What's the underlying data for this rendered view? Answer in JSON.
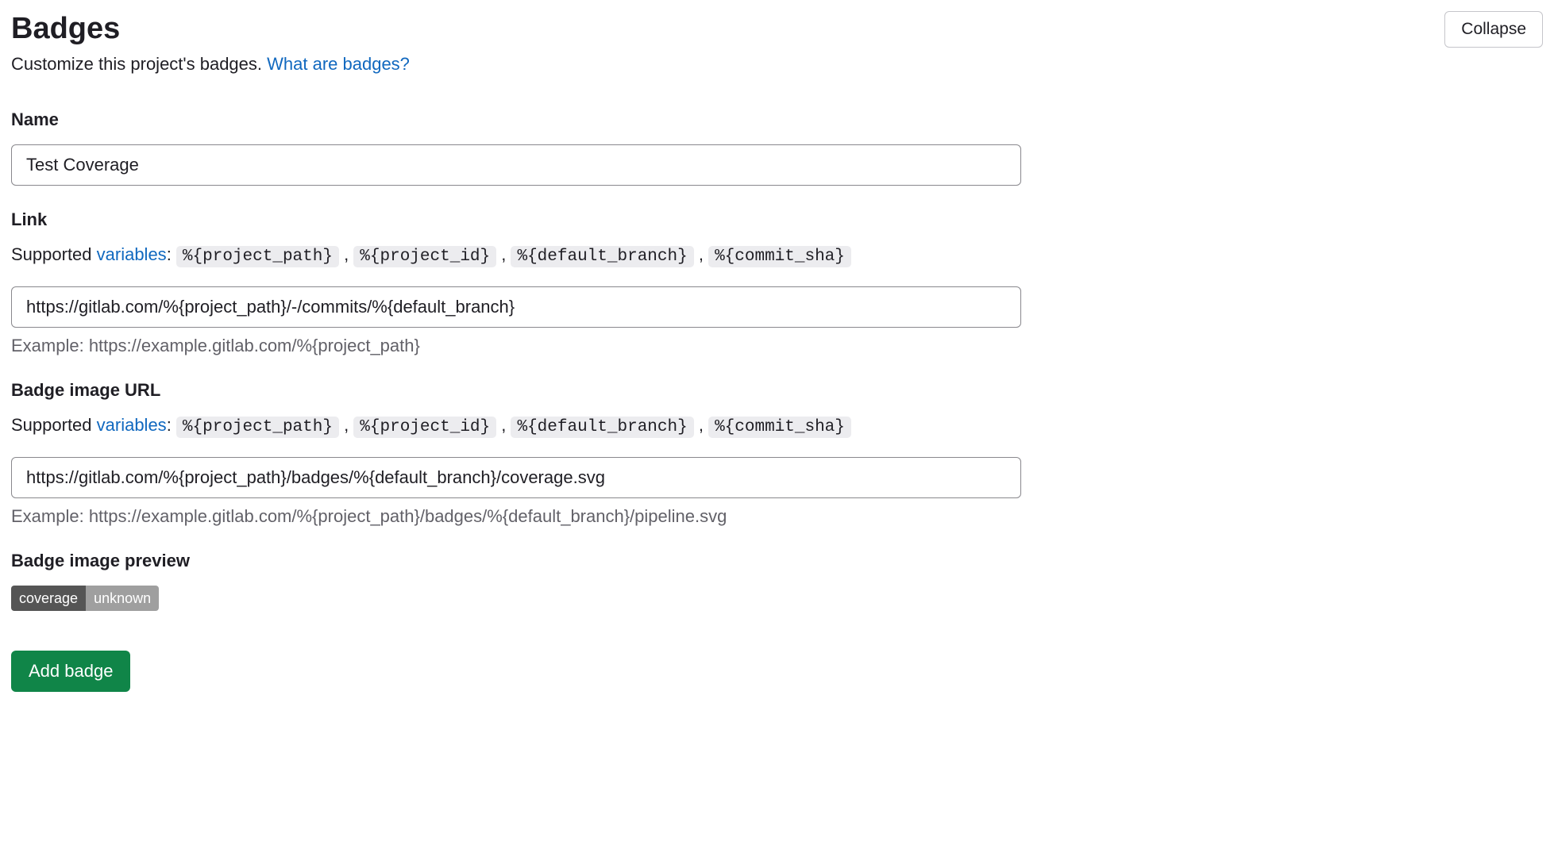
{
  "header": {
    "title": "Badges",
    "collapse_label": "Collapse",
    "subtitle_text": "Customize this project's badges. ",
    "subtitle_link": "What are badges?"
  },
  "name_field": {
    "label": "Name",
    "value": "Test Coverage"
  },
  "link_field": {
    "label": "Link",
    "supported_prefix": "Supported ",
    "supported_link": "variables",
    "supported_colon": ": ",
    "vars": [
      "%{project_path}",
      "%{project_id}",
      "%{default_branch}",
      "%{commit_sha}"
    ],
    "value": "https://gitlab.com/%{project_path}/-/commits/%{default_branch}",
    "example": "Example: https://example.gitlab.com/%{project_path}"
  },
  "image_url_field": {
    "label": "Badge image URL",
    "supported_prefix": "Supported ",
    "supported_link": "variables",
    "supported_colon": ": ",
    "vars": [
      "%{project_path}",
      "%{project_id}",
      "%{default_branch}",
      "%{commit_sha}"
    ],
    "value": "https://gitlab.com/%{project_path}/badges/%{default_branch}/coverage.svg",
    "example": "Example: https://example.gitlab.com/%{project_path}/badges/%{default_branch}/pipeline.svg"
  },
  "preview": {
    "label": "Badge image preview",
    "left": "coverage",
    "right": "unknown"
  },
  "add_button_label": "Add badge"
}
